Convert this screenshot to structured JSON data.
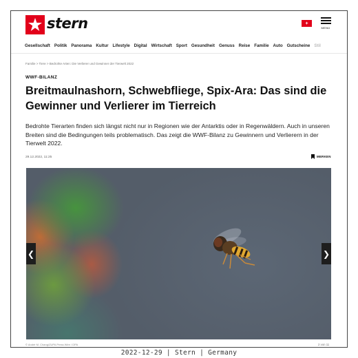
{
  "header": {
    "logo_text": "stern",
    "plus_badge": "+",
    "menu_label": "MENÜ"
  },
  "nav": {
    "items": [
      "Gesellschaft",
      "Politik",
      "Panorama",
      "Kultur",
      "Lifestyle",
      "Digital",
      "Wirtschaft",
      "Sport",
      "Gesundheit",
      "Genuss",
      "Reise",
      "Familie",
      "Auto",
      "Gutscheine",
      "Stil"
    ]
  },
  "article": {
    "breadcrumb": "Familie > Tiere > Bedrohte Arten: Die Verlierer und Gewinner der Tierwelt 2022",
    "kicker": "WWF-BILANZ",
    "headline": "Breitmaulnashorn, Schwebfliege, Spix-Ara: Das sind die Gewinner und Verlierer im Tierreich",
    "teaser": "Bedrohte Tierarten finden sich längst nicht nur in Regionen wie der Antarktis oder in Regenwäldern. Auch in unseren Breiten sind die Bedingungen teils problematisch. Das zeigt die WWF-Bilanz zu Gewinnern und Verlierern in der Tierwelt 2022.",
    "date": "29.12.2022, 11:25",
    "bookmark_label": "MERKEN"
  },
  "gallery": {
    "prev_arrow": "❮",
    "next_arrow": "❯",
    "credit": "© André M. Chang/ZUPA Press Wire / DPA",
    "counter": "2 von 11"
  },
  "caption": "2022-12-29 | Stern | Germany",
  "colors": {
    "brand_red": "#e2001a"
  }
}
